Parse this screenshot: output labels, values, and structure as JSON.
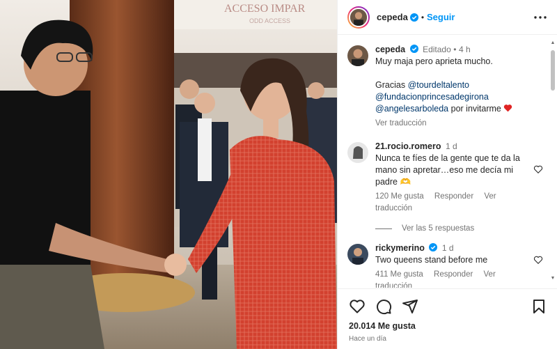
{
  "photo": {
    "sign_text": "ACCESO IMPAR",
    "sign_subtext": "ODD ACCESS"
  },
  "header": {
    "username": "cepeda",
    "separator": "•",
    "follow_label": "Seguir"
  },
  "caption": {
    "username": "cepeda",
    "status": "Editado",
    "separator": "•",
    "time": "4 h",
    "line1": "Muy maja pero aprieta mucho.",
    "thanks_prefix": "Gracias",
    "mention1": "@tourdeltalento",
    "mention2": "@fundacionprincesadegirona",
    "mention3": "@angelesarboleda",
    "suffix": "por invitarme",
    "translate": "Ver traducción"
  },
  "comments": [
    {
      "username": "21.rocio.romero",
      "time": "1 d",
      "text": "Nunca te fíes de la gente que te da la mano sin apretar…eso me decía mi padre 🫶",
      "likes": "120 Me gusta",
      "reply": "Responder",
      "translate": "Ver traducción",
      "replies": "Ver las 5 respuestas"
    },
    {
      "username": "rickymerino",
      "time": "1 d",
      "text": "Two queens stand before me",
      "likes": "411 Me gusta",
      "reply": "Responder",
      "translate": "Ver traducción"
    }
  ],
  "footer": {
    "likes": "20.014 Me gusta",
    "time": "Hace un día"
  },
  "colors": {
    "accent_blue": "#0095f6",
    "link": "#00376b",
    "muted": "#737373",
    "heart_red": "#ed4956"
  },
  "icons": [
    "more-icon",
    "verified-icon",
    "heart-icon",
    "comment-icon",
    "share-icon",
    "bookmark-icon"
  ]
}
